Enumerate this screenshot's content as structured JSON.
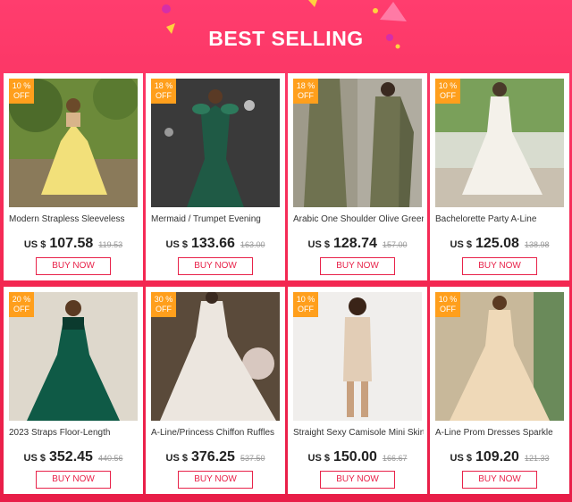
{
  "header": {
    "title": "BEST SELLING"
  },
  "colors": {
    "background": "#f2254f",
    "accent": "#e8234a",
    "badge": "#ff9f1c"
  },
  "products": [
    {
      "discount": "10 %",
      "off": "OFF",
      "name": "Modern Strapless Sleeveless",
      "currency": "US $",
      "price": "107.58",
      "old_price": "119.53",
      "button": "BUY NOW",
      "image": "yellow-tulle-dress-photo"
    },
    {
      "discount": "18 %",
      "off": "OFF",
      "name": "Mermaid / Trumpet Evening",
      "currency": "US $",
      "price": "133.66",
      "old_price": "163.00",
      "button": "BUY NOW",
      "image": "green-sequin-mermaid-dress-photo"
    },
    {
      "discount": "18 %",
      "off": "OFF",
      "name": "Arabic One Shoulder Olive Green",
      "currency": "US $",
      "price": "128.74",
      "old_price": "157.00",
      "button": "BUY NOW",
      "image": "olive-green-cape-dress-photo"
    },
    {
      "discount": "10 %",
      "off": "OFF",
      "name": "Bachelorette Party A-Line",
      "currency": "US $",
      "price": "125.08",
      "old_price": "138.98",
      "button": "BUY NOW",
      "image": "white-strapless-dress-photo"
    },
    {
      "discount": "20 %",
      "off": "OFF",
      "name": "2023 Straps Floor-Length",
      "currency": "US $",
      "price": "352.45",
      "old_price": "440.56",
      "button": "BUY NOW",
      "image": "emerald-tulle-gown-photo"
    },
    {
      "discount": "30 %",
      "off": "OFF",
      "name": "A-Line/Princess Chiffon Ruffles",
      "currency": "US $",
      "price": "376.25",
      "old_price": "537.50",
      "button": "BUY NOW",
      "image": "white-ruffle-gown-photo"
    },
    {
      "discount": "10 %",
      "off": "OFF",
      "name": "Straight Sexy Camisole Mini Skirt",
      "currency": "US $",
      "price": "150.00",
      "old_price": "166.67",
      "button": "BUY NOW",
      "image": "beige-mini-dress-photo"
    },
    {
      "discount": "10 %",
      "off": "OFF",
      "name": "A-Line Prom Dresses Sparkle",
      "currency": "US $",
      "price": "109.20",
      "old_price": "121.33",
      "button": "BUY NOW",
      "image": "champagne-sparkle-gown-photo"
    }
  ]
}
